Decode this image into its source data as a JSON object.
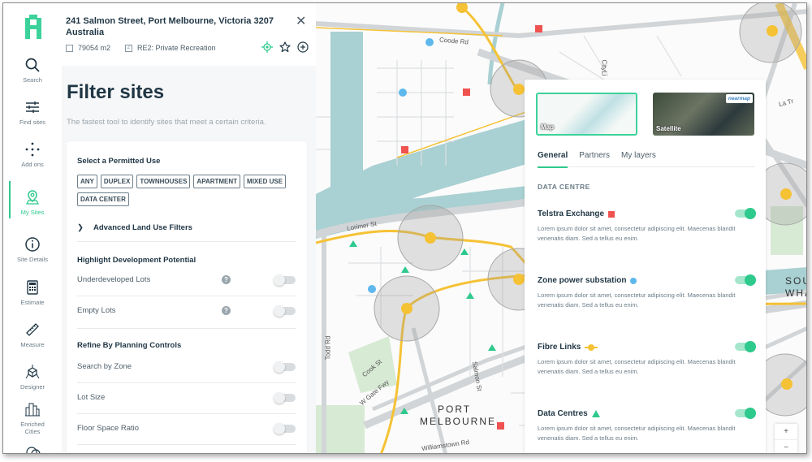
{
  "nav": {
    "logo": "app-logo",
    "items": [
      {
        "label": "Search",
        "icon": "search-icon"
      },
      {
        "label": "Find sites",
        "icon": "sliders-icon"
      },
      {
        "label": "Add ons",
        "icon": "dots-icon"
      },
      {
        "label": "My Sites",
        "icon": "map-pin-icon",
        "active": true
      },
      {
        "label": "Site Details",
        "icon": "info-icon"
      },
      {
        "label": "Estimate",
        "icon": "calculator-icon"
      },
      {
        "label": "Measure",
        "icon": "ruler-icon"
      },
      {
        "label": "Designer",
        "icon": "cube-icon"
      },
      {
        "label": "Enriched Cities",
        "icon": "city-icon"
      }
    ]
  },
  "site": {
    "address": "241 Salmon Street, Port Melbourne, Victoria 3207 Australia",
    "area": "79054 m2",
    "zone": "RE2: Private Recreation",
    "zone_icon_text": "Z"
  },
  "filter": {
    "title": "Filter sites",
    "subtitle": "The fastest tool to identify sites that meet a certain criteria.",
    "permitted_use_heading": "Select a Permitted Use",
    "permitted_uses": [
      "ANY",
      "DUPLEX",
      "TOWNHOUSES",
      "APARTMENT",
      "MIXED USE",
      "DATA CENTER"
    ],
    "advanced_label": "Advanced Land Use Filters",
    "dev_potential_heading": "Highlight Development Potential",
    "dev_potential_rows": [
      {
        "label": "Underdeveloped Lots",
        "help": "?",
        "on": false
      },
      {
        "label": "Empty Lots",
        "help": "?",
        "on": false
      }
    ],
    "planning_heading": "Refine By Planning Controls",
    "planning_rows": [
      {
        "label": "Search by Zone",
        "on": false
      },
      {
        "label": "Lot Size",
        "on": false
      },
      {
        "label": "Floor Space Ratio",
        "on": false
      }
    ]
  },
  "map": {
    "labels": {
      "coode": "Coode Rd",
      "lorimer": "Lorimer St",
      "todd": "Todd Rd",
      "cook": "Cook St",
      "wgate": "W Gate Fwy",
      "salmon": "Salmon St",
      "williamstown": "Williamstown Rd",
      "port1": "PORT",
      "port2": "MELBOURNE",
      "south1": "SOU",
      "south2": "WHA",
      "cityl": "CityLi",
      "latrobe": "La Tr"
    },
    "colors": {
      "water": "#a9d0d2",
      "park": "#d7ead4",
      "road": "#d2d5d7",
      "fibre": "#f5c235",
      "telstra": "#ef5350",
      "substation": "#5eb8ec",
      "datacentre": "#2ec98d"
    },
    "zoom_in": "+",
    "zoom_out": "−"
  },
  "layers": {
    "basemaps": [
      {
        "label": "Map",
        "selected": true
      },
      {
        "label": "Satellite",
        "selected": false,
        "brand": "nearmap"
      }
    ],
    "tabs": [
      {
        "label": "General",
        "active": true
      },
      {
        "label": "Partners",
        "active": false
      },
      {
        "label": "My layers",
        "active": false
      }
    ],
    "category": "DATA CENTRE",
    "items": [
      {
        "name": "Telstra Exchange",
        "swatch": "square",
        "on": true,
        "desc": "Lorem ipsum dolor sit amet, consectetur adipiscing elit. Maecenas blandit venenatis diam. Sed a tellus eu enim."
      },
      {
        "name": "Zone power substation",
        "swatch": "circle",
        "on": true,
        "desc": "Lorem ipsum dolor sit amet, consectetur adipiscing elit. Maecenas blandit venenatis diam. Sed a tellus eu enim."
      },
      {
        "name": "Fibre Links",
        "swatch": "line",
        "on": true,
        "desc": "Lorem ipsum dolor sit amet, consectetur adipiscing elit. Maecenas blandit venenatis diam. Sed a tellus eu enim."
      },
      {
        "name": "Data Centres",
        "swatch": "triangle",
        "on": true,
        "desc": "Lorem ipsum dolor sit amet, consectetur adipiscing elit. Maecenas blandit venenatis diam. Sed a tellus eu enim."
      }
    ]
  }
}
